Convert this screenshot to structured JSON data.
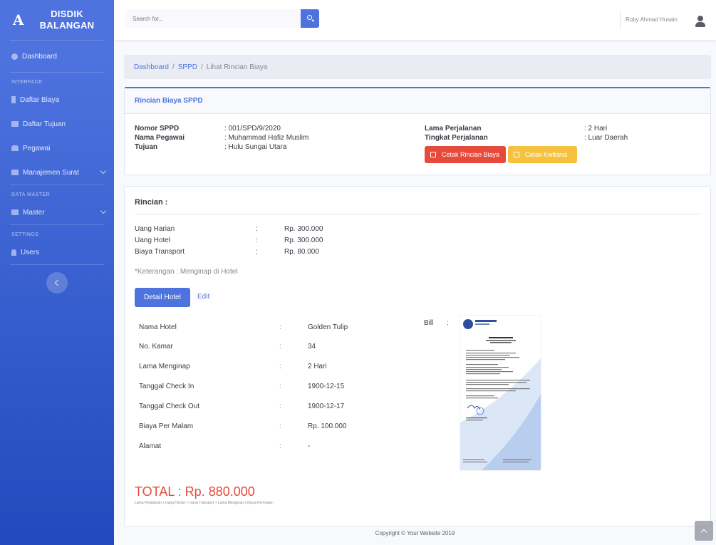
{
  "colors": {
    "primary": "#4e73df",
    "danger": "#e74a3b",
    "warning": "#f6c23e",
    "sidebar_gradient_end": "#224abe"
  },
  "brand": {
    "logo": "A",
    "line1": "DISDIK",
    "line2": "BALANGAN"
  },
  "sidebar": {
    "dashboard": "Dashboard",
    "heading_interface": "INTERFACE",
    "daftar_biaya": "Daftar Biaya",
    "daftar_tujuan": "Daftar Tujuan",
    "pegawai": "Pegawai",
    "manajemen_surat": "Manajemen Surat",
    "heading_data_master": "DATA MASTER",
    "master": "Master",
    "heading_settings": "SETTINGS",
    "users": "Users"
  },
  "topbar": {
    "search_placeholder": "Search for...",
    "username": "Roby Ahmad Husain"
  },
  "breadcrumb": {
    "item1": "Dashboard",
    "sep": "/",
    "item2": "SPPD",
    "item3": "Lihat Rincian Biaya"
  },
  "rincian_card": {
    "title": "Rincian Biaya SPPD",
    "nomor_label": "Nomor SPPD",
    "nomor_value": ": 001/SPD/9/2020",
    "nama_label": "Nama Pegawai",
    "nama_value": ": Muhammad Hafiz Muslim",
    "tujuan_label": "Tujuan",
    "tujuan_value": ": Hulu Sungai Utara",
    "lama_label": "Lama Perjalanan",
    "lama_value": ": 2 Hari",
    "tingkat_label": "Tingkat Perjalanan",
    "tingkat_value": ": Luar Daerah",
    "btn_cetak_rincian": "Cetak Rincian Biaya",
    "btn_cetak_kwitansi": "Cetak Kwitansi"
  },
  "detail_card": {
    "title": "Rincian :",
    "costs": [
      {
        "label": "Uang Harian",
        "colon": ":",
        "value": "Rp. 300.000"
      },
      {
        "label": "Uang Hotel",
        "colon": ":",
        "value": "Rp. 300.000"
      },
      {
        "label": "Biaya Transport",
        "colon": ":",
        "value": "Rp. 80.000"
      }
    ],
    "note": "*Keterangan : Menginap di Hotel",
    "btn_detail_hotel": "Detail Hotel",
    "link_edit": "Edit",
    "hotel": [
      {
        "label": "Nama Hotel",
        "colon": ":",
        "value": "Golden Tulip"
      },
      {
        "label": "No. Kamar",
        "colon": ":",
        "value": "34"
      },
      {
        "label": "Lama Menginap",
        "colon": ":",
        "value": "2 Hari"
      },
      {
        "label": "Tanggal Check In",
        "colon": ":",
        "value": "1900-12-15"
      },
      {
        "label": "Tanggal Check Out",
        "colon": ":",
        "value": "1900-12-17"
      },
      {
        "label": "Biaya Per Malam",
        "colon": ":",
        "value": "Rp. 100.000"
      },
      {
        "label": "Alamat",
        "colon": ":",
        "value": "-"
      }
    ],
    "bill_label": "Bill",
    "bill_colon": ":",
    "total": "TOTAL : Rp. 880.000",
    "formula": "Lama Perjalanan x Uang Harian + Uang Transport + Lama Menginap x Biaya Permalam"
  },
  "footer": {
    "copyright": "Copyright © Your Website 2019"
  }
}
